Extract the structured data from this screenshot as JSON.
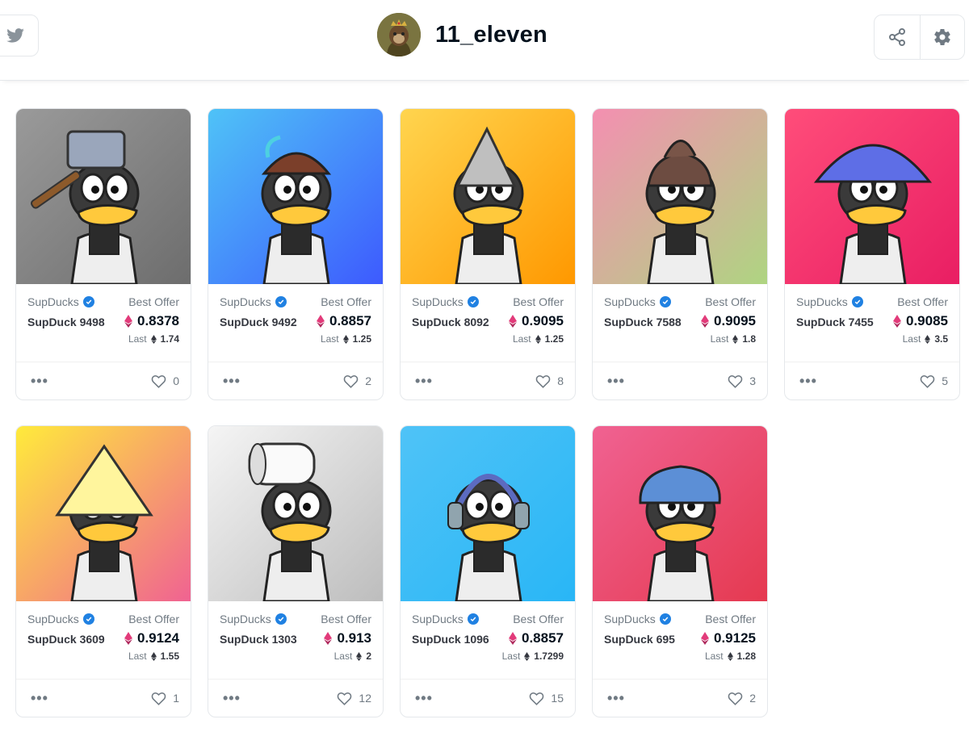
{
  "header": {
    "username": "11_eleven",
    "icons": {
      "twitter": "twitter-icon",
      "share": "share-icon",
      "settings": "gear-icon",
      "avatar": "ape-avatar"
    }
  },
  "colors": {
    "accent": "#2081e2",
    "eth_pink": "#e23b7a",
    "text": "#353840",
    "muted": "#707a83"
  },
  "labels": {
    "best_offer": "Best Offer",
    "last": "Last",
    "more": "•••"
  },
  "cards": [
    {
      "collection": "SupDucks",
      "name": "SupDuck 9498",
      "offer": "0.8378",
      "last": "1.74",
      "likes": "0"
    },
    {
      "collection": "SupDucks",
      "name": "SupDuck 9492",
      "offer": "0.8857",
      "last": "1.25",
      "likes": "2"
    },
    {
      "collection": "SupDucks",
      "name": "SupDuck 8092",
      "offer": "0.9095",
      "last": "1.25",
      "likes": "8"
    },
    {
      "collection": "SupDucks",
      "name": "SupDuck 7588",
      "offer": "0.9095",
      "last": "1.8",
      "likes": "3"
    },
    {
      "collection": "SupDucks",
      "name": "SupDuck 7455",
      "offer": "0.9085",
      "last": "3.5",
      "likes": "5"
    },
    {
      "collection": "SupDucks",
      "name": "SupDuck 3609",
      "offer": "0.9124",
      "last": "1.55",
      "likes": "1"
    },
    {
      "collection": "SupDucks",
      "name": "SupDuck 1303",
      "offer": "0.913",
      "last": "2",
      "likes": "12"
    },
    {
      "collection": "SupDucks",
      "name": "SupDuck 1096",
      "offer": "0.8857",
      "last": "1.7299",
      "likes": "15"
    },
    {
      "collection": "SupDucks",
      "name": "SupDuck 695",
      "offer": "0.9125",
      "last": "1.28",
      "likes": "2"
    }
  ]
}
